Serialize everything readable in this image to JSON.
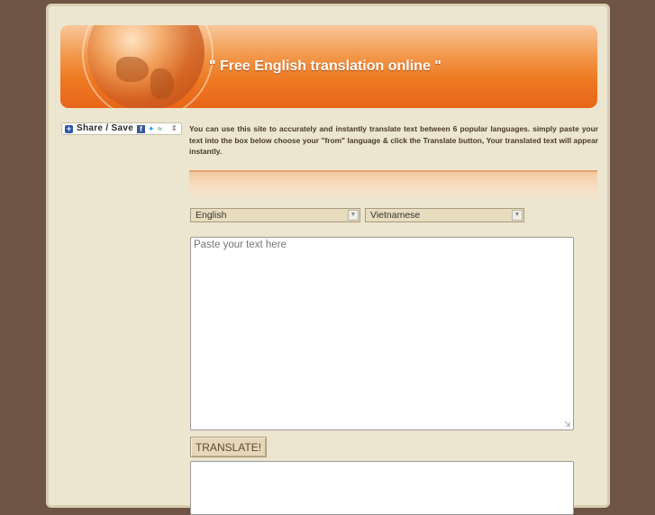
{
  "header": {
    "title": "\" Free English translation online \""
  },
  "share": {
    "label": "Share / Save",
    "icons": [
      "plus-icon",
      "facebook-icon",
      "twitter-icon",
      "google-icon",
      "dropdown-arrow-icon"
    ]
  },
  "intro": {
    "text": "You can use this site to accurately and instantly translate text between 6 popular languages. simply paste your text into the box below choose your \"from\" language & click the Translate button, Your translated text will appear instantly."
  },
  "translator": {
    "from_language": "English",
    "to_language": "Vietnamese",
    "input_placeholder": "Paste your text here",
    "input_value": "",
    "translate_label": "TRANSLATE!",
    "output_value": ""
  },
  "colors": {
    "page_background": "#6e5444",
    "content_background": "#ece5cf",
    "header_orange": "#ee7a22",
    "text_brown": "#4a3a2a"
  }
}
